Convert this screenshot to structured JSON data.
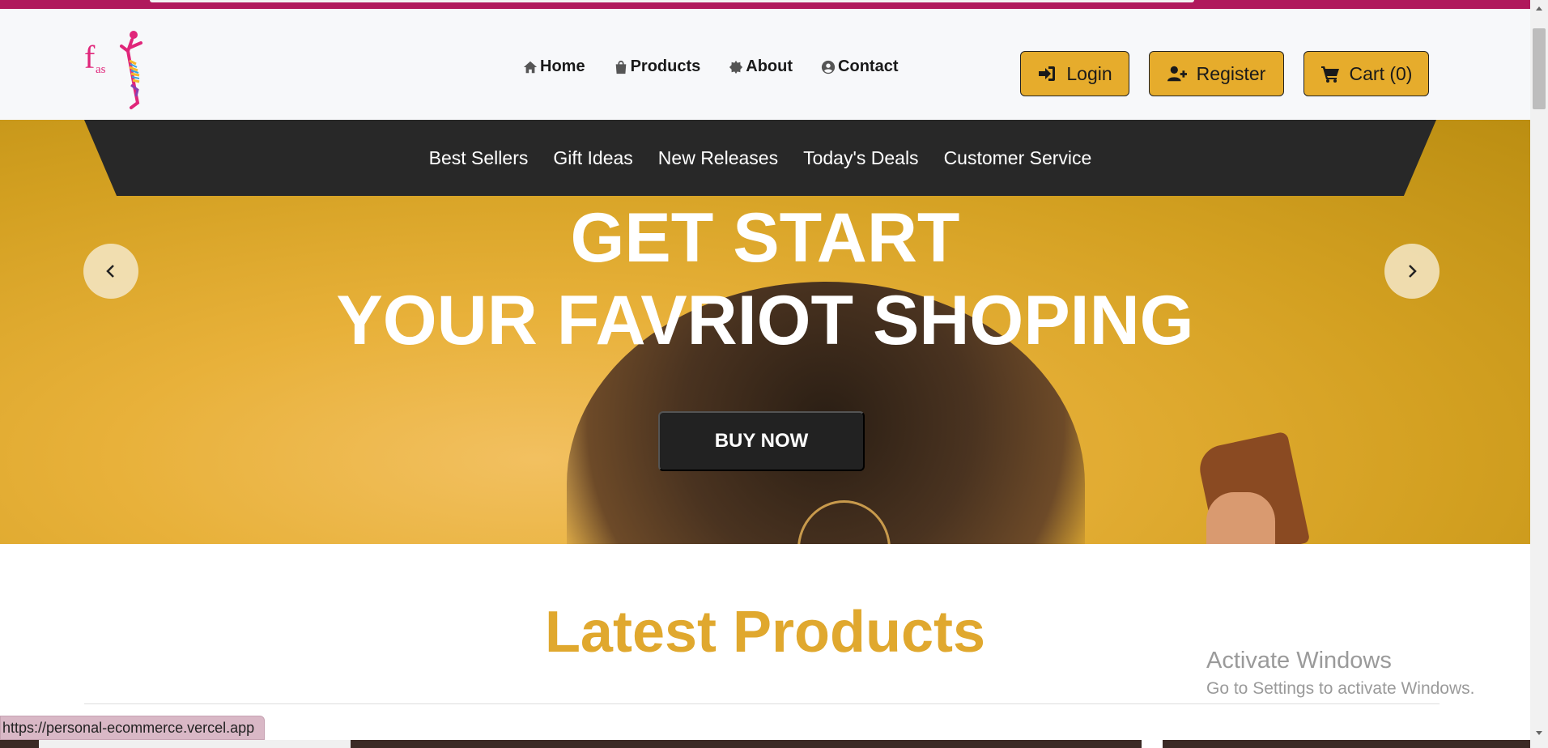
{
  "colors": {
    "accent": "#e6ac2c",
    "brand": "#b0195c",
    "dark": "#282828",
    "heading": "#e0a82e"
  },
  "logo": {
    "text_f": "f",
    "text_as": "as"
  },
  "main_nav": [
    {
      "label": "Home",
      "icon": "home-icon"
    },
    {
      "label": "Products",
      "icon": "shopping-bag-icon"
    },
    {
      "label": "About",
      "icon": "badge-icon"
    },
    {
      "label": "Contact",
      "icon": "user-circle-icon"
    }
  ],
  "auth": {
    "login_label": "Login",
    "register_label": "Register",
    "cart_label": "Cart (0)"
  },
  "subnav": [
    "Best Sellers",
    "Gift Ideas",
    "New Releases",
    "Today's Deals",
    "Customer Service"
  ],
  "hero": {
    "title_line1": "GET START",
    "title_line2": "YOUR FAVRIOT SHOPING",
    "cta_label": "BUY NOW"
  },
  "section": {
    "title": "Latest Products"
  },
  "windows": {
    "activate_title": "Activate Windows",
    "activate_sub": "Go to Settings to activate Windows."
  },
  "status_bar": {
    "url": "https://personal-ecommerce.vercel.app"
  }
}
